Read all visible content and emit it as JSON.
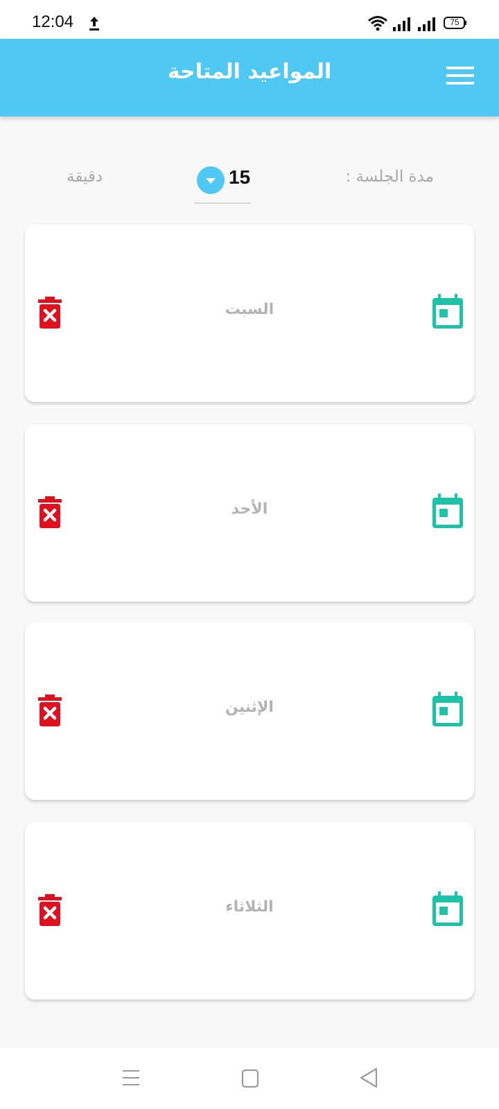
{
  "status_bar": {
    "time": "12:04",
    "battery": "75",
    "icons": [
      "upload-icon",
      "wifi-icon",
      "signal-icon",
      "signal-icon",
      "battery-icon"
    ]
  },
  "app_bar": {
    "title": "المواعيد المتاحة",
    "menu_icon": "hamburger-menu-icon",
    "background_color": "#4fc9f3"
  },
  "duration": {
    "label": "مدة الجلسة :",
    "value": "15",
    "unit": "دقيقة",
    "dropdown_icon": "dropdown-arrow-icon"
  },
  "days": [
    {
      "name": "السبت"
    },
    {
      "name": "الأحد"
    },
    {
      "name": "الإثنين"
    },
    {
      "name": "الثلاثاء"
    }
  ],
  "colors": {
    "accent": "#4fc9f3",
    "delete": "#e0101e",
    "calendar": "#1ec2a6",
    "muted_text": "#a9a9a9"
  },
  "nav_bar": {
    "icons": [
      "menu-icon",
      "home-icon",
      "back-icon"
    ]
  }
}
